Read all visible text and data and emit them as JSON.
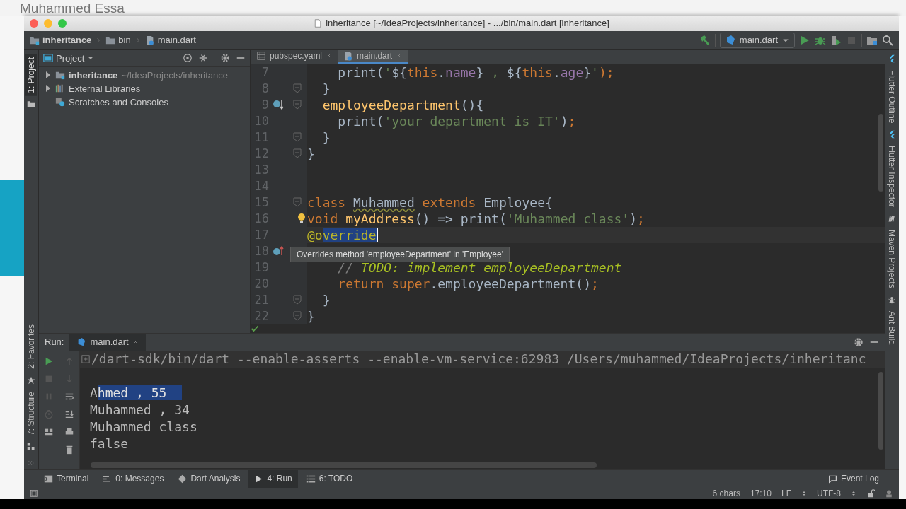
{
  "page_header": {
    "author": "Muhammed Essa"
  },
  "window": {
    "title": "inheritance [~/IdeaProjects/inheritance] - .../bin/main.dart [inheritance]"
  },
  "breadcrumbs": [
    {
      "label": "inheritance",
      "kind": "module"
    },
    {
      "label": "bin",
      "kind": "folder"
    },
    {
      "label": "main.dart",
      "kind": "dart"
    }
  ],
  "run_config": {
    "label": "main.dart"
  },
  "left_stripe": [
    {
      "label": "1: Project",
      "selected": true,
      "kind": "project"
    },
    {
      "label": "2: Favorites",
      "selected": false,
      "kind": "favorites"
    },
    {
      "label": "7: Structure",
      "selected": false,
      "kind": "structure"
    }
  ],
  "right_stripe": [
    {
      "label": "Flutter Outline",
      "kind": "flutter"
    },
    {
      "label": "Flutter Inspector",
      "kind": "flutter"
    },
    {
      "label": "Maven Projects",
      "kind": "maven"
    },
    {
      "label": "Ant Build",
      "kind": "ant"
    }
  ],
  "project": {
    "title": "Project",
    "tree": [
      {
        "label": "inheritance",
        "path": "~/IdeaProjects/inheritance",
        "expanded": false,
        "kind": "module"
      },
      {
        "label": "External Libraries",
        "expanded": false,
        "kind": "library"
      },
      {
        "label": "Scratches and Consoles",
        "kind": "scratch"
      }
    ]
  },
  "editor_tabs": [
    {
      "label": "pubspec.yaml",
      "kind": "yaml",
      "selected": false
    },
    {
      "label": "main.dart",
      "kind": "dart",
      "selected": true
    }
  ],
  "code_lines": [
    {
      "number": "7",
      "fold": false,
      "kind": "plain",
      "tokens": [
        {
          "text": "    print(",
          "kind": "plain"
        },
        {
          "text": "'",
          "kind": "str"
        },
        {
          "text": "${",
          "kind": "plain"
        },
        {
          "text": "this",
          "kind": "kw"
        },
        {
          "text": ".",
          "kind": "plain"
        },
        {
          "text": "name",
          "kind": "field"
        },
        {
          "text": "}",
          "kind": "plain"
        },
        {
          "text": " , ",
          "kind": "str"
        },
        {
          "text": "${",
          "kind": "plain"
        },
        {
          "text": "this",
          "kind": "kw"
        },
        {
          "text": ".",
          "kind": "plain"
        },
        {
          "text": "age",
          "kind": "field"
        },
        {
          "text": "}",
          "kind": "plain"
        },
        {
          "text": "'",
          "kind": "str"
        },
        {
          "text": ");",
          "kind": "kw"
        }
      ]
    },
    {
      "number": "8",
      "fold": true,
      "kind": "plain",
      "tokens": [
        {
          "text": "  }",
          "kind": "plain"
        }
      ]
    },
    {
      "number": "9",
      "fold": true,
      "kind": "overridden",
      "tokens": [
        {
          "text": "  employeeDepartment",
          "kind": "fn"
        },
        {
          "text": "(){",
          "kind": "plain"
        }
      ]
    },
    {
      "number": "10",
      "fold": false,
      "kind": "plain",
      "tokens": [
        {
          "text": "    print(",
          "kind": "plain"
        },
        {
          "text": "'your department is IT'",
          "kind": "str"
        },
        {
          "text": ")",
          "kind": "plain"
        },
        {
          "text": ";",
          "kind": "kw"
        }
      ]
    },
    {
      "number": "11",
      "fold": true,
      "kind": "plain",
      "tokens": [
        {
          "text": "  }",
          "kind": "plain"
        }
      ]
    },
    {
      "number": "12",
      "fold": true,
      "kind": "plain",
      "tokens": [
        {
          "text": "}",
          "kind": "plain"
        }
      ]
    },
    {
      "number": "13",
      "fold": false,
      "kind": "plain"
    },
    {
      "number": "14",
      "fold": false,
      "kind": "plain"
    },
    {
      "number": "15",
      "fold": true,
      "kind": "plain",
      "tokens": [
        {
          "text": "class ",
          "kind": "kw"
        },
        {
          "text": "Muhammed",
          "kind": "warn"
        },
        {
          "text": " extends",
          "kind": "kw"
        },
        {
          "text": " Employee{",
          "kind": "plain"
        }
      ]
    },
    {
      "number": "16",
      "fold": false,
      "kind": "plain",
      "bulb": true,
      "tokens": [
        {
          "text": "void ",
          "kind": "kw"
        },
        {
          "text": "myAddress",
          "kind": "fn"
        },
        {
          "text": "() => print(",
          "kind": "plain"
        },
        {
          "text": "'Muhammed class'",
          "kind": "str"
        },
        {
          "text": ")",
          "kind": "plain"
        },
        {
          "text": ";",
          "kind": "kw"
        }
      ]
    },
    {
      "number": "17",
      "fold": false,
      "kind": "plain",
      "caret": true,
      "tokens": [
        {
          "text": "@o",
          "kind": "annot"
        },
        {
          "text": "verride",
          "kind": "selection"
        }
      ]
    },
    {
      "number": "18",
      "fold": false,
      "kind": "overriding"
    },
    {
      "number": "19",
      "fold": false,
      "kind": "plain",
      "tokens": [
        {
          "text": "    // ",
          "kind": "comment"
        },
        {
          "text": "TODO: implement employeeDepartment",
          "kind": "todo"
        }
      ]
    },
    {
      "number": "20",
      "fold": false,
      "kind": "plain",
      "tokens": [
        {
          "text": "    return super",
          "kind": "kw"
        },
        {
          "text": ".employeeDepartment()",
          "kind": "plain"
        },
        {
          "text": ";",
          "kind": "kw"
        }
      ]
    },
    {
      "number": "21",
      "fold": true,
      "kind": "plain",
      "tokens": [
        {
          "text": "  }",
          "kind": "plain"
        }
      ]
    },
    {
      "number": "22",
      "fold": true,
      "kind": "plain",
      "tokens": [
        {
          "text": "}",
          "kind": "plain"
        }
      ]
    }
  ],
  "tooltip": {
    "text": "Overrides method 'employeeDepartment' in 'Employee'"
  },
  "run_panel": {
    "title": "Run:",
    "tab": "main.dart",
    "command": "/dart-sdk/bin/dart --enable-asserts --enable-vm-service:62983 /Users/muhammed/IdeaProjects/inheritanc",
    "output": [
      {
        "tokens": [
          {
            "text": "A",
            "selected": false
          },
          {
            "text": "hmed , 55",
            "selected": true
          }
        ]
      },
      {
        "tokens": [
          {
            "text": "Muhammed , 34",
            "selected": false
          }
        ]
      },
      {
        "tokens": [
          {
            "text": "Muhammed class",
            "selected": false
          }
        ]
      },
      {
        "tokens": [
          {
            "text": "false",
            "selected": false
          }
        ]
      }
    ]
  },
  "tool_tabs": [
    {
      "label": "Terminal",
      "kind": "terminal",
      "selected": false
    },
    {
      "label": "0: Messages",
      "kind": "messages",
      "selected": false
    },
    {
      "label": "Dart Analysis",
      "kind": "analysis",
      "selected": false
    },
    {
      "label": "4: Run",
      "kind": "run",
      "selected": true
    },
    {
      "label": "6: TODO",
      "kind": "todo",
      "selected": false
    }
  ],
  "event_log": {
    "label": "Event Log"
  },
  "status_bar": {
    "chars": "6 chars",
    "position": "17:10",
    "line_sep": "LF",
    "encoding": "UTF-8"
  }
}
